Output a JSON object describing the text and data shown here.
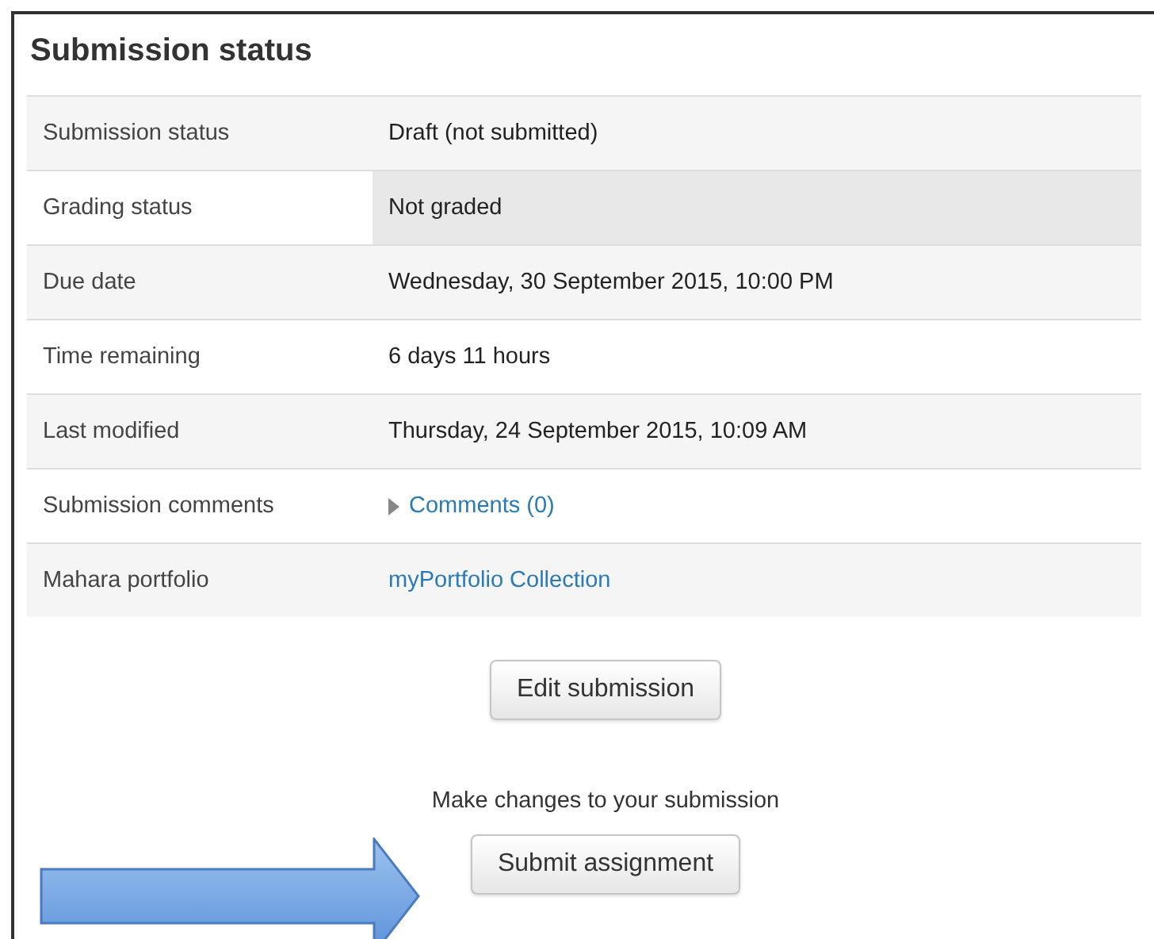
{
  "heading": "Submission status",
  "rows": [
    {
      "label": "Submission status",
      "value": "Draft (not submitted)",
      "kind": "text",
      "highlighted": false
    },
    {
      "label": "Grading status",
      "value": "Not graded",
      "kind": "text",
      "highlighted": true
    },
    {
      "label": "Due date",
      "value": "Wednesday, 30 September 2015, 10:00 PM",
      "kind": "text",
      "highlighted": false
    },
    {
      "label": "Time remaining",
      "value": "6 days 11 hours",
      "kind": "text",
      "highlighted": false
    },
    {
      "label": "Last modified",
      "value": "Thursday, 24 September 2015, 10:09 AM",
      "kind": "text",
      "highlighted": false
    },
    {
      "label": "Submission comments",
      "value": "Comments (0)",
      "kind": "expander",
      "highlighted": false
    },
    {
      "label": "Mahara portfolio",
      "value": "myPortfolio Collection",
      "kind": "link",
      "highlighted": false
    }
  ],
  "edit_button": "Edit submission",
  "note": "Make changes to your submission",
  "submit_button": "Submit assignment"
}
